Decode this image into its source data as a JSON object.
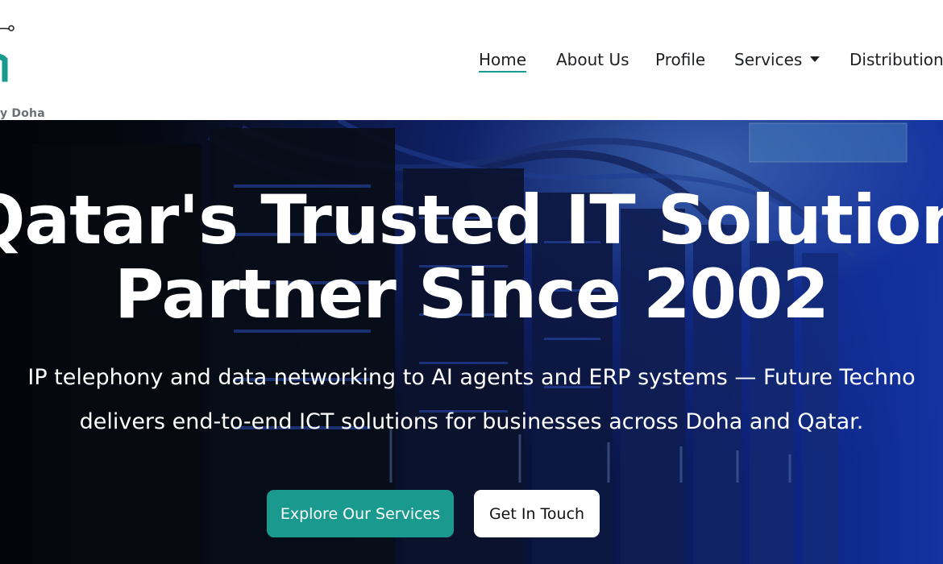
{
  "header": {
    "logo_text": "y Doha",
    "nav": {
      "home": "Home",
      "about": "About Us",
      "profile": "Profile",
      "services": "Services",
      "distribution": "Distribution"
    }
  },
  "hero": {
    "title_line1": "Qatar's Trusted IT Solutions",
    "title_line2": "Partner Since 2002",
    "subtitle_line1": "IP telephony and data networking to AI agents and ERP systems — Future Techno",
    "subtitle_line2": "delivers end-to-end ICT solutions for businesses across Doha and Qatar.",
    "primary_button": "Explore Our Services",
    "secondary_button": "Get In Touch"
  },
  "colors": {
    "accent": "#1a9a8e",
    "nav_text": "#1d1f22",
    "hero_blue": "#1b49e0"
  },
  "icons": {
    "logo": "company-logo-icon",
    "services_dropdown": "caret-down-icon"
  }
}
